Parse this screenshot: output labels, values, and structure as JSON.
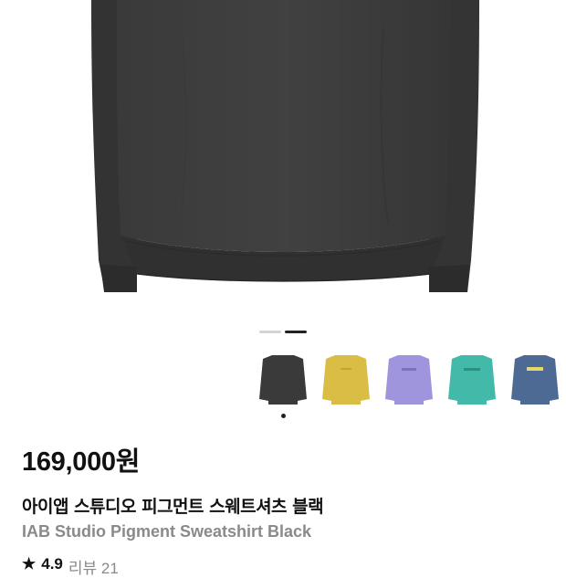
{
  "gallery": {
    "page_count": 2,
    "active_page": 2
  },
  "swatches": [
    {
      "color": "#3a3a3a",
      "accent": "#3a3a3a",
      "name": "Black",
      "selected": true
    },
    {
      "color": "#d9bd45",
      "accent": "#c8ab33",
      "name": "Yellow",
      "selected": false
    },
    {
      "color": "#9e95dc",
      "accent": "#7b71c4",
      "name": "Purple",
      "selected": false
    },
    {
      "color": "#42b9a9",
      "accent": "#f1e36c",
      "name": "Green",
      "selected": false
    },
    {
      "color": "#4d6a95",
      "accent": "#e6d76a",
      "name": "Blue",
      "selected": false
    }
  ],
  "product": {
    "price": "169,000원",
    "name_ko": "아이앱 스튜디오 피그먼트 스웨트셔츠 블랙",
    "name_en": "IAB Studio Pigment Sweatshirt Black",
    "rating_star": "★",
    "rating": "4.9",
    "reviews": "리뷰 21"
  }
}
